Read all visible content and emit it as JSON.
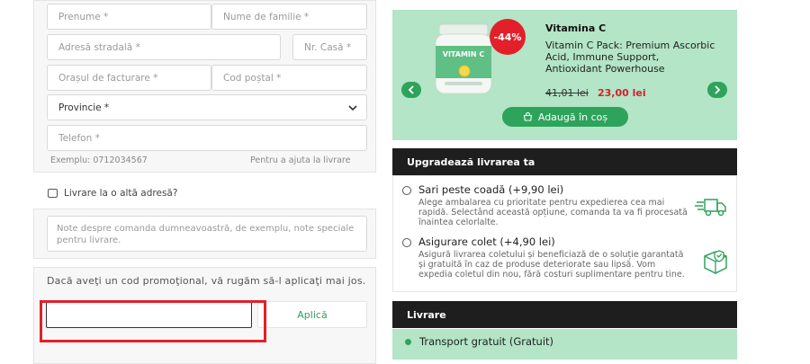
{
  "billing": {
    "first_name_placeholder": "Prenume *",
    "last_name_placeholder": "Nume de familie *",
    "street_placeholder": "Adresă stradală *",
    "house_no_placeholder": "Nr. Casă *",
    "city_placeholder": "Orașul de facturare *",
    "postal_placeholder": "Cod poștal *",
    "province_value": "Provincie *",
    "phone_placeholder": "Telefon *",
    "phone_example": "Exemplu: 0712034567",
    "phone_hint": "Pentru a ajuta la livrare"
  },
  "ship_other": {
    "label": "Livrare la o altă adresă?",
    "checked": false
  },
  "notes": {
    "placeholder": "Note despre comanda dumneavoastră, de exemplu, note speciale pentru livrare."
  },
  "promo": {
    "text": "Dacă aveţi un cod promoţional, vă rugăm să-l aplicaţi mai jos.",
    "input_value": "",
    "apply_label": "Aplică"
  },
  "product": {
    "badge": "-44%",
    "title": "Vitamina C",
    "description": "Vitamin C Pack: Premium Ascorbic Acid, Immune Support, Antioxidant Powerhouse",
    "price_old": "41,01 lei",
    "price_new": "23,00 lei",
    "add_label": "Adaugă în coș",
    "jar_label": "VITAMIN C",
    "colors": {
      "card_bg": "#b3e5c6",
      "accent": "#2ea35b",
      "badge": "#e3202a"
    }
  },
  "upgrade": {
    "header": "Upgradează livrarea ta",
    "options": [
      {
        "title": "Sari peste coadă (+9,90 lei)",
        "desc": "Alege ambalarea cu prioritate pentru expedierea cea mai rapidă. Selectând această opțiune, comanda ta va fi procesată înaintea celorlalte.",
        "icon": "fast-truck-icon"
      },
      {
        "title": "Asigurare colet (+4,90 lei)",
        "desc": "Asigură livrarea coletului și beneficiază de o soluție garantată și gratuită în caz de produse deteriorate sau lipsă. Vom expedia coletul din nou, fără costuri suplimentare pentru tine.",
        "icon": "insured-package-icon"
      }
    ]
  },
  "delivery": {
    "header": "Livrare",
    "option": "Transport gratuit (Gratuit)"
  },
  "annotation": {
    "color": "#e3202a"
  }
}
